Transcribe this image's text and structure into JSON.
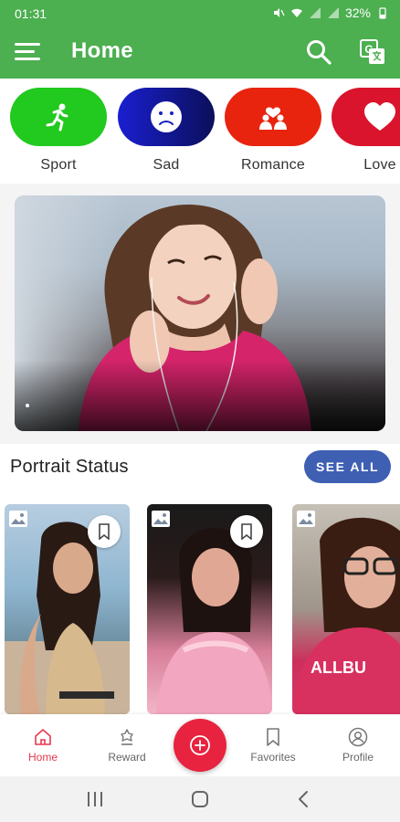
{
  "status_bar": {
    "time": "01:31",
    "battery": "32%"
  },
  "app_bar": {
    "title": "Home",
    "menu_icon": "hamburger-menu-icon",
    "search_icon": "search-icon",
    "translate_icon": "translate-icon"
  },
  "categories": [
    {
      "label": "Sport",
      "icon": "running-person-icon",
      "color": "#22c91e"
    },
    {
      "label": "Sad",
      "icon": "sad-face-icon",
      "color": "#1a1fbf"
    },
    {
      "label": "Romance",
      "icon": "couple-heart-icon",
      "color": "#e8240f"
    },
    {
      "label": "Love",
      "icon": "heart-icon",
      "color": "#d9142c"
    }
  ],
  "banner": {
    "image": "portrait-photo"
  },
  "section": {
    "title": "Portrait Status",
    "see_all": "SEE ALL"
  },
  "portrait_cards": [
    {
      "image": "portrait-photo",
      "badge_icon": "image-icon",
      "action_icon": "bookmark-icon"
    },
    {
      "image": "portrait-photo",
      "badge_icon": "image-icon",
      "action_icon": "bookmark-icon"
    },
    {
      "image": "portrait-photo",
      "badge_icon": "image-icon",
      "action_icon": "bookmark-icon"
    }
  ],
  "bottom_nav": {
    "items": [
      {
        "label": "Home",
        "icon": "home-icon",
        "active": true
      },
      {
        "label": "Reward",
        "icon": "reward-icon",
        "active": false
      },
      {
        "label": "Favorites",
        "icon": "bookmark-icon",
        "active": false
      },
      {
        "label": "Profile",
        "icon": "profile-icon",
        "active": false
      }
    ],
    "fab_icon": "add-icon"
  },
  "colors": {
    "app_bar": "#4caf50",
    "accent": "#e8233f",
    "see_all_button": "#3f5fb3",
    "active_nav": "#e53950"
  }
}
